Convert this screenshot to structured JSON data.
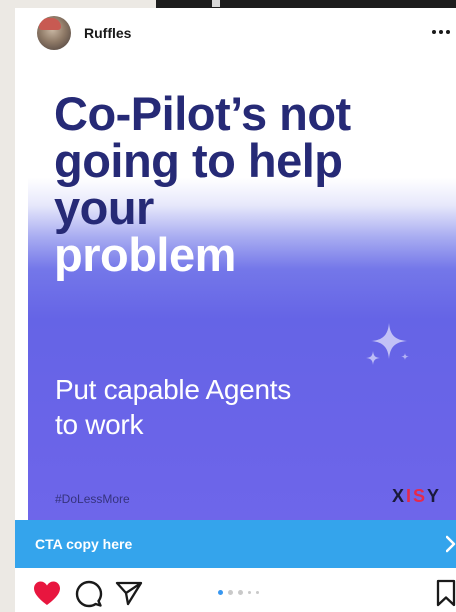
{
  "header": {
    "username": "Ruffles"
  },
  "post": {
    "headline_lines": [
      "Co-Pilot’s not",
      "going to help",
      "your",
      "problem"
    ],
    "subhead_lines": [
      "Put capable Agents",
      "to work"
    ],
    "hashtag": "#DoLessMore",
    "logo": {
      "part1": "X",
      "part2": "IS",
      "part3": "Y"
    },
    "colors": {
      "headline_dark": "#262a76",
      "gradient_purple": "#6564e6",
      "logo_accent": "#e6294b"
    }
  },
  "cta": {
    "label": "CTA copy here",
    "color": "#34a4ec"
  },
  "actions": {
    "icons": [
      "heart-icon",
      "comment-icon",
      "share-icon",
      "bookmark-icon"
    ],
    "carousel": {
      "count": 5,
      "active_index": 0
    },
    "like_color": "#e8163f"
  }
}
